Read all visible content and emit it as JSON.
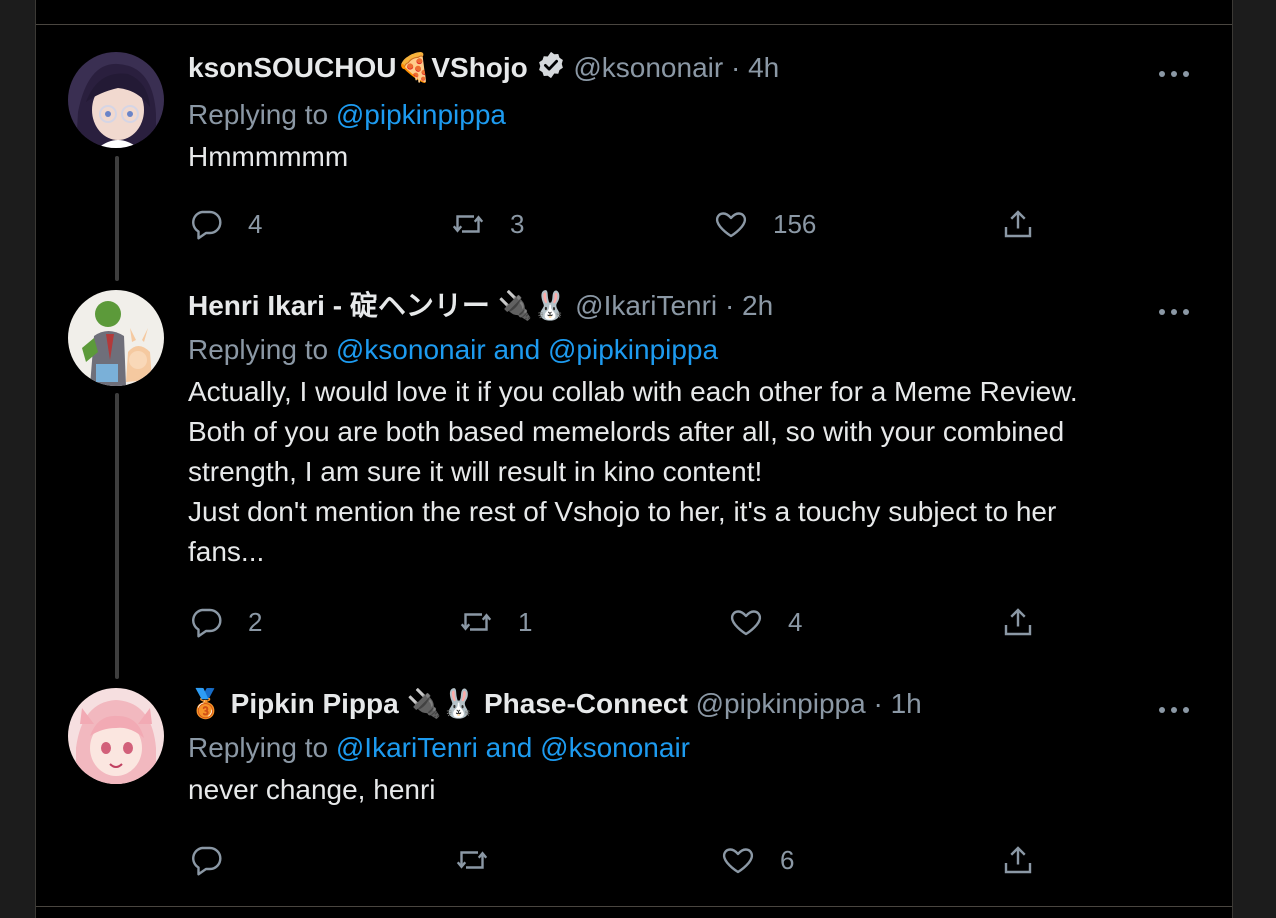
{
  "tweets": [
    {
      "name": "ksonSOUCHOU",
      "name_suffix": "VShojo",
      "name_emoji": "🍕",
      "verified": true,
      "handle": "@ksononair",
      "time": "4h",
      "reply_prefix": "Replying to ",
      "reply_targets": "@pipkinpippa",
      "text": "Hmmmmmm",
      "replies": "4",
      "retweets": "3",
      "likes": "156"
    },
    {
      "name": "Henri Ikari - 碇ヘンリー",
      "name_emoji": "🔌🐰",
      "handle": "@IkariTenri",
      "time": "2h",
      "reply_prefix": "Replying to ",
      "reply_targets": "@ksononair and @pipkinpippa",
      "text": "Actually, I would love it if you collab with each other for a Meme Review.\nBoth of you are both based memelords after all, so with your combined\nstrength, I am sure it will result in kino content!\nJust don't mention the rest of Vshojo to her, it's a touchy subject to her\nfans...",
      "replies": "2",
      "retweets": "1",
      "likes": "4"
    },
    {
      "name_prefix_emoji": "🥉",
      "name": "Pipkin Pippa",
      "name_emoji": "🔌🐰",
      "name_suffix": "Phase-Connect",
      "handle": "@pipkinpippa",
      "time": "1h",
      "reply_prefix": "Replying to ",
      "reply_targets": "@IkariTenri and @ksononair",
      "text": "never change, henri",
      "replies": "",
      "retweets": "",
      "likes": "6"
    }
  ],
  "separator": "·",
  "colors": {
    "background": "#000000",
    "text": "#e7e9ea",
    "muted": "#8b98a5",
    "link": "#1d9bf0"
  },
  "icons": [
    "reply-icon",
    "retweet-icon",
    "like-icon",
    "share-icon",
    "more-icon",
    "verified-icon"
  ]
}
